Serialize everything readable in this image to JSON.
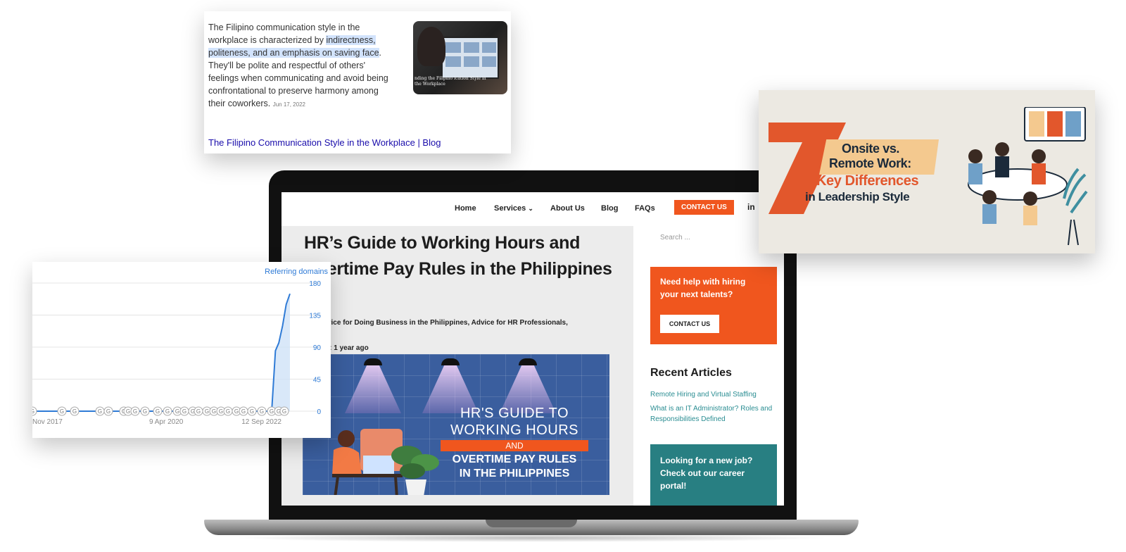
{
  "laptop_site": {
    "nav": {
      "home": "Home",
      "services": "Services",
      "about": "About Us",
      "blog": "Blog",
      "faqs": "FAQs",
      "contact_cta": "CONTACT US",
      "social_icon": "linkedin-icon"
    },
    "article": {
      "title": "HR’s Guide to Working Hours and Overtime Pay Rules in the Philippines",
      "categories_line1": "ies: Advice for Doing Business in the Philippines, Advice for HR Professionals,",
      "categories_line2": "phics",
      "date_line": "ed Date: 1 year ago",
      "hero": {
        "line1": "HR'S GUIDE TO",
        "line2": "WORKING HOURS",
        "and": "AND",
        "line3": "OVERTIME PAY RULES",
        "line4": "IN THE PHILIPPINES"
      }
    },
    "sidebar": {
      "search_placeholder": "Search ...",
      "help_title": "Need help with hiring your next talents?",
      "help_button": "CONTACT US",
      "recent_title": "Recent Articles",
      "recent_links": [
        "Remote Hiring and Virtual Staffing",
        "What is an IT Administrator? Roles and Responsibilities Defined"
      ],
      "job_title": "Looking for a new job? Check out our career portal!"
    }
  },
  "snippet": {
    "text_a": "The Filipino communication style in the workplace is characterized by ",
    "text_highlight": "indirectness, politeness, and an emphasis on saving face",
    "text_b": ". They'll be polite and respectful of others' feelings when communicating and avoid being confrontational to preserve harmony among their coworkers.",
    "date": "Jun 17, 2022",
    "thumb_caption": "nding the Filipino ication Style in the Workplace",
    "link": "The Filipino Communication Style in the Workplace | Blog"
  },
  "chart_data": {
    "type": "line",
    "title": "",
    "legend": [
      "Referring domains"
    ],
    "legend_position": "top-right",
    "x_tick_labels": [
      "Nov 2017",
      "9 Apr 2020",
      "12 Sep 2022"
    ],
    "y_tick_labels": [
      "180",
      "135",
      "90",
      "45",
      "0"
    ],
    "ylim": [
      0,
      180
    ],
    "grid": true,
    "y_axis_side": "right",
    "series": [
      {
        "name": "Referring domains",
        "color": "#2f7bd6",
        "fill": "#cfe2f7",
        "x": [
          "2017-08",
          "2022-09",
          "2023-01",
          "2023-02",
          "2023-03",
          "2023-04",
          "2023-05",
          "2023-06"
        ],
        "values": [
          0,
          0,
          0,
          85,
          96,
          120,
          150,
          165
        ]
      }
    ],
    "event_marker_label": "G"
  },
  "banner": {
    "number": "7",
    "line1": "Onsite vs.",
    "line2": "Remote Work:",
    "line3": "Key Differences",
    "line4": "in Leadership Style",
    "accent": "#e2572c",
    "navy": "#1b2a3a"
  }
}
